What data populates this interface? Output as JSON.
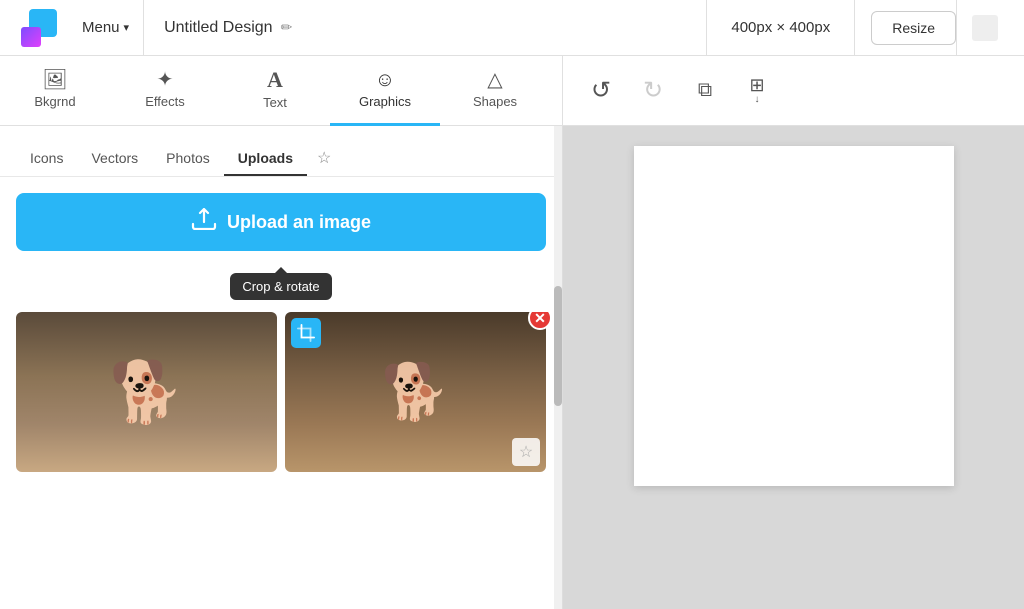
{
  "header": {
    "menu_label": "Menu",
    "menu_chevron": "▾",
    "title": "Untitled Design",
    "edit_icon": "✏",
    "dimensions": "400px × 400px",
    "resize_label": "Resize"
  },
  "toolbar": {
    "tabs": [
      {
        "id": "bkgrnd",
        "label": "Bkgrnd",
        "icon": "🖼",
        "active": false
      },
      {
        "id": "effects",
        "label": "Effects",
        "icon": "✦",
        "active": false
      },
      {
        "id": "text",
        "label": "Text",
        "icon": "A",
        "active": false
      },
      {
        "id": "graphics",
        "label": "Graphics",
        "icon": "☺",
        "active": true
      },
      {
        "id": "shapes",
        "label": "Shapes",
        "icon": "△",
        "active": false
      }
    ],
    "actions": [
      {
        "id": "undo",
        "icon": "↺",
        "disabled": false
      },
      {
        "id": "redo",
        "icon": "↻",
        "disabled": true
      },
      {
        "id": "duplicate",
        "icon": "⧉",
        "disabled": false
      },
      {
        "id": "layers",
        "icon": "⊞↓",
        "disabled": false
      }
    ]
  },
  "sub_tabs": [
    {
      "id": "icons",
      "label": "Icons",
      "active": false
    },
    {
      "id": "vectors",
      "label": "Vectors",
      "active": false
    },
    {
      "id": "photos",
      "label": "Photos",
      "active": false
    },
    {
      "id": "uploads",
      "label": "Uploads",
      "active": true
    },
    {
      "id": "favorites",
      "label": "★",
      "active": false
    }
  ],
  "upload_button": {
    "label": "Upload an image",
    "icon": "☁"
  },
  "tooltip": {
    "text": "Crop & rotate"
  },
  "images": [
    {
      "id": "image-1",
      "alt": "Dog on couch",
      "has_crop": false,
      "has_remove": false,
      "has_star": false
    },
    {
      "id": "image-2",
      "alt": "Dog on couch 2",
      "has_crop": true,
      "has_remove": true,
      "has_star": true
    }
  ]
}
